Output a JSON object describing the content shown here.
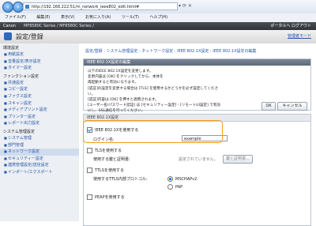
{
  "browser": {
    "url": "http://192.168.222.51/m_network_ieee802_edit.html#",
    "menu": [
      "ファイル(F)",
      "編集(E)",
      "表示(V)",
      "お気に入り(A)",
      "ツール(T)",
      "ヘルプ(H)"
    ]
  },
  "appheader": {
    "brand": "Canon",
    "path": "MF8580C Series / MF8580C Series /",
    "right": "ポータルへ   ログアウト"
  },
  "titlebar": {
    "title": "設定/登録",
    "mgmode": "管理者モード"
  },
  "sidebar": {
    "groups": [
      {
        "head": "環境設定",
        "items": [
          "用紙設定",
          "音量設定/表示設定",
          "タイマー設定"
        ]
      },
      {
        "head": "ファンクション設定",
        "items": [
          "共通設定",
          "コピー設定",
          "ファクス設定",
          "スキャン設定",
          "メディアプリント設定",
          "プリンター設定",
          "レポート出力設定"
        ]
      },
      {
        "head": "システム管理設定",
        "items": [
          "システム管理",
          "部門管理",
          "ネットワーク設定",
          "セキュリティー設定",
          "連携管理設定/送信設定",
          "インポート/エクスポート"
        ]
      }
    ]
  },
  "main": {
    "breadcrumb": "設定/登録 : システム管理設定 : ネットワーク設定 : IEEE 802.1X設定 : IEEE 802.1X設定の編集",
    "notice": {
      "head": "IEEE 802.1X設定の編集",
      "text": "以下のIEEE 802.1X設定を変更します。\n変更内容は [OK] をクリックしてから、本体を\n再起動すると有効になります。\n[認証]の設定を変更する場合は [TLS] を使用するかどうかを必ず設定してください。\n[認証]内容は [OK] を押すと適用されます。\n[ユーザー名/パスワード認証] は [セキュリティー設定] - [リモートUI設定] で有効にし、SSL通信を行ってください。",
      "ok": "OK",
      "cancel": "キャンセル"
    },
    "settings": {
      "head": "IEEE 802.1X設定",
      "use_ieee": "IEEE 802.1Xを使用する",
      "login_label": "ログイン名:",
      "login_value": "example",
      "tls_label": "TLSを使用する",
      "cert_label": "使用する鍵と証明書:",
      "cert_status": "設定されていません。",
      "cert_button": "鍵と証明書...",
      "ttls_label": "TTLSを使用する",
      "ttls_protocol_label": "使用するTTLS内部プロトコル:",
      "mschap": "MSCHAPv2",
      "pap": "PAP",
      "peap_label": "PEAPを使用する"
    }
  }
}
